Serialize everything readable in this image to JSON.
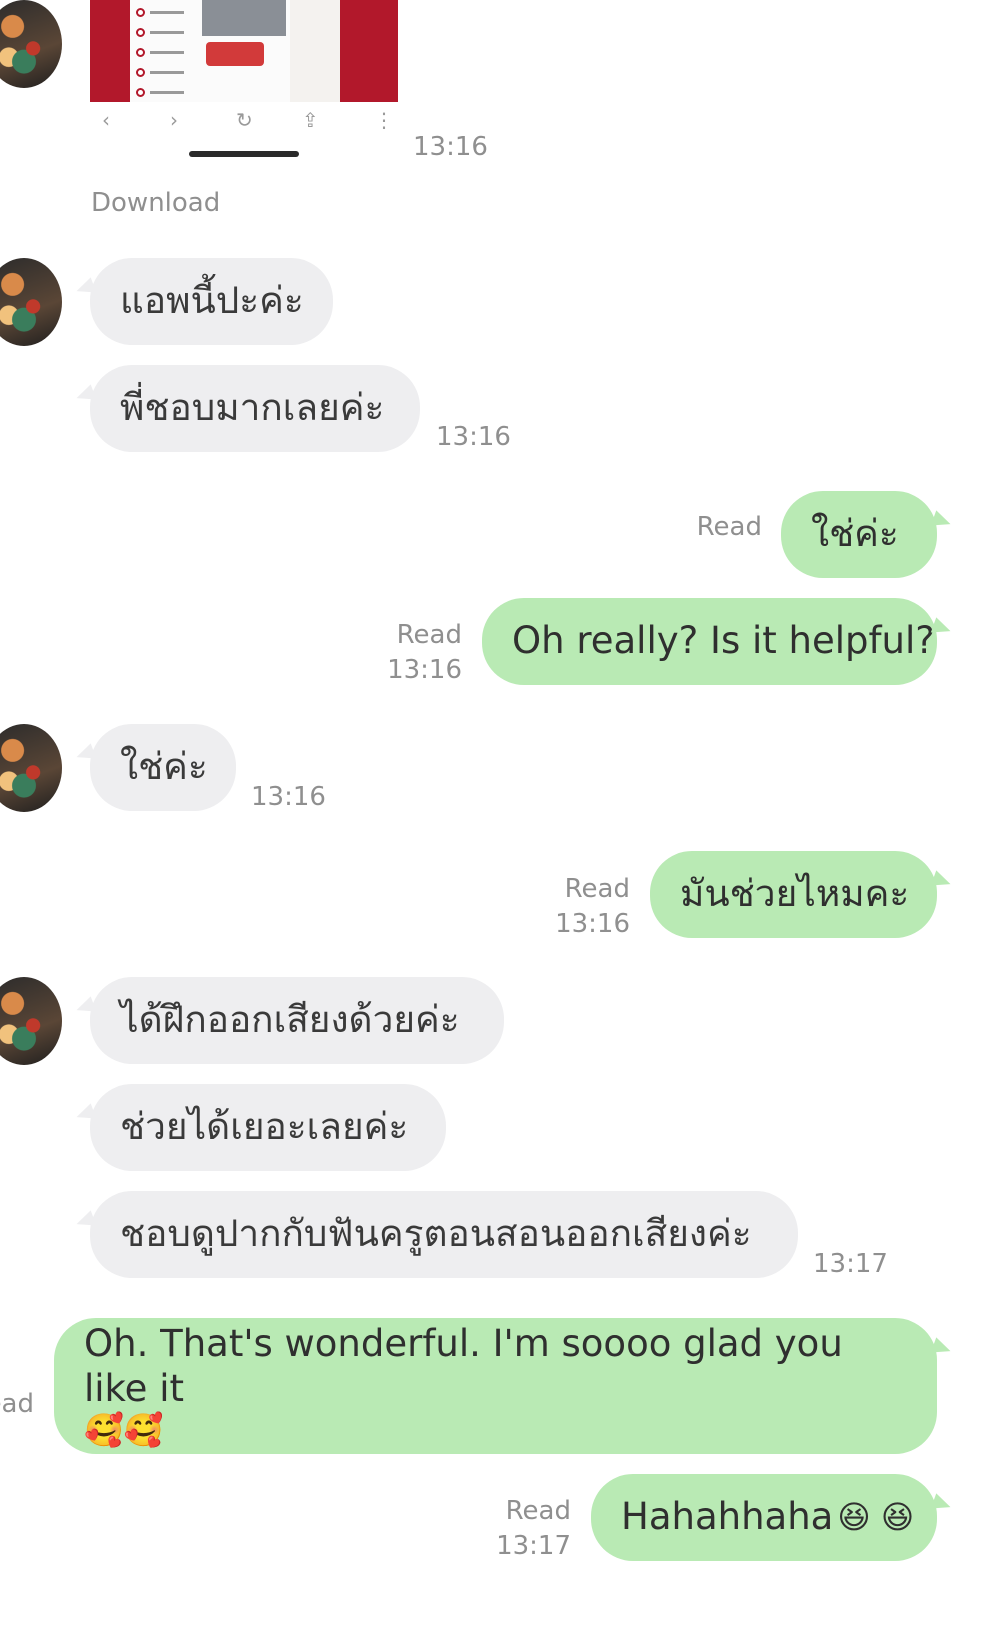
{
  "shared_image": {
    "nav_icons": [
      "back-arrow-icon",
      "forward-arrow-icon",
      "reload-icon",
      "share-icon",
      "more-icon"
    ],
    "nav_glyphs": [
      "‹",
      "›",
      "↻",
      "⇪",
      "⋮"
    ],
    "time": "13:16",
    "download_label": "Download"
  },
  "messages": [
    {
      "text": "แอพนี้ปะค่ะ"
    },
    {
      "text": "พี่ชอบมากเลยค่ะ",
      "time": "13:16"
    },
    {
      "text": "ใช่ค่ะ",
      "read": "Read"
    },
    {
      "text": "Oh really? Is it helpful?",
      "read": "Read",
      "time": "13:16"
    },
    {
      "text": "ใช่ค่ะ",
      "time": "13:16"
    },
    {
      "text": "มันช่วยไหมคะ",
      "read": "Read",
      "time": "13:16"
    },
    {
      "text": "ได้ฝึกออกเสียงด้วยค่ะ"
    },
    {
      "text": "ช่วยได้เยอะเลยค่ะ"
    },
    {
      "text": "ชอบดูปากกับฟันครูตอนสอนออกเสียงค่ะ",
      "time": "13:17"
    },
    {
      "text": "Oh. That's wonderful. I'm soooo glad you like it",
      "emoji": "🥰🥰",
      "read": "ead"
    },
    {
      "text": "Hahahhaha",
      "emoji": "😆 😆",
      "read": "Read",
      "time": "13:17"
    }
  ],
  "colors": {
    "incoming_bubble": "#eeeef0",
    "outgoing_bubble": "#b9eab4",
    "meta_text": "#8f8f8f"
  }
}
